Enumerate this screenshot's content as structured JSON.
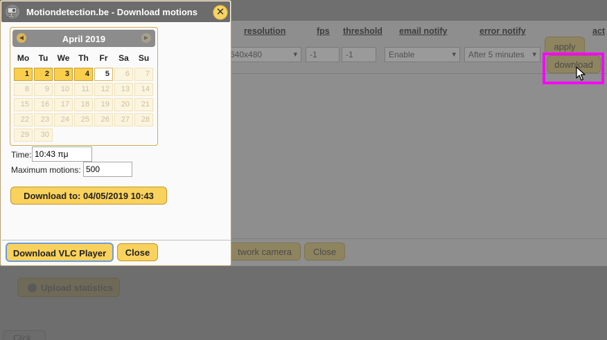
{
  "background": {
    "columns": [
      "resolution",
      "fps",
      "threshold",
      "email notify",
      "error notify",
      "act"
    ],
    "fields": {
      "resolution": "640x480",
      "fps": "-1",
      "threshold": "-1",
      "email_notify": "Enable",
      "error_notify": "After 5 minutes"
    },
    "apply_label": "apply",
    "download_label": "download",
    "network_camera_label": "twork camera",
    "close_label": "Close",
    "upload_stats_label": "Upload statistics",
    "small_btn_label": "Click"
  },
  "dialog": {
    "title": "Motiondetection.be - Download motions",
    "close_icon": "close-icon",
    "calendar": {
      "month": "April 2019",
      "weekdays": [
        "Mo",
        "Tu",
        "We",
        "Th",
        "Fr",
        "Sa",
        "Su"
      ],
      "days": [
        "1",
        "2",
        "3",
        "4",
        "5",
        "6",
        "7",
        "8",
        "9",
        "10",
        "11",
        "12",
        "13",
        "14",
        "15",
        "16",
        "17",
        "18",
        "19",
        "20",
        "21",
        "22",
        "23",
        "24",
        "25",
        "26",
        "27",
        "28",
        "29",
        "30"
      ]
    },
    "time_label": "Time:",
    "time_value": "10:43 πμ",
    "max_motions_label": "Maximum motions:",
    "max_motions_value": "500",
    "download_to_label": "Download to: 04/05/2019 10:43",
    "vlc_label": "Download VLC Player",
    "close_label": "Close"
  },
  "colors": {
    "accent_yellow": "#f9d15d",
    "highlight": "#ff00ff",
    "titlebar": "#6c6c6c"
  }
}
